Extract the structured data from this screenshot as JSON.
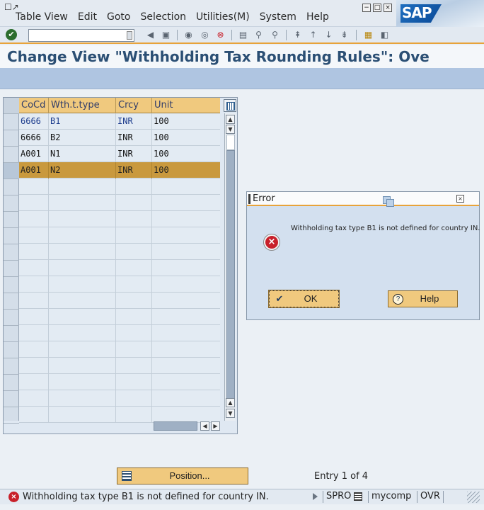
{
  "menu": {
    "items": [
      "Table View",
      "Edit",
      "Goto",
      "Selection",
      "Utilities(M)",
      "System",
      "Help"
    ]
  },
  "brand": {
    "logo_text": "SAP"
  },
  "window_controls": [
    "minimize",
    "restore",
    "close"
  ],
  "title": "Change View \"Withholding Tax Rounding Rules\": Ove",
  "table": {
    "columns": [
      "CoCd",
      "Wth.t.type",
      "Crcy",
      "Unit"
    ],
    "rows": [
      [
        "6666",
        "B1",
        "INR",
        "100"
      ],
      [
        "6666",
        "B2",
        "INR",
        "100"
      ],
      [
        "A001",
        "N1",
        "INR",
        "100"
      ],
      [
        "A001",
        "N2",
        "INR",
        "100"
      ]
    ],
    "selected_row": 3
  },
  "dialog": {
    "title": "Error",
    "message": "Withholding tax type B1 is not defined for country IN.",
    "ok_label": "OK",
    "help_label": "Help"
  },
  "position_button": "Position...",
  "entry_text": "Entry 1 of 4",
  "status": {
    "message": "Withholding tax type B1 is not defined for country IN.",
    "transaction": "SPRO",
    "system": "mycomp",
    "mode": "OVR"
  },
  "colors": {
    "accent": "#e8a33a",
    "title": "#2b4f74",
    "header": "#f0c97e",
    "selected_row": "#c9993e",
    "error": "#c8202a"
  }
}
